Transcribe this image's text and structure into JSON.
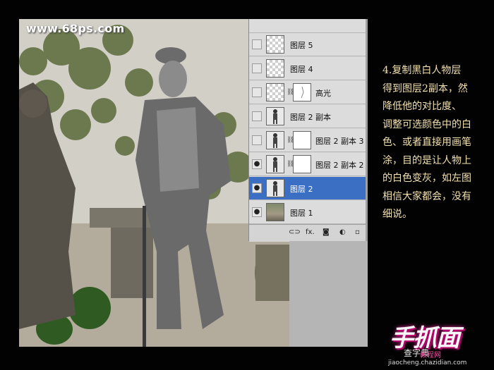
{
  "watermark": "www.68ps.com",
  "layers": [
    {
      "name": "图层 5",
      "visible": false,
      "thumb": "checker",
      "link": false,
      "mask": false
    },
    {
      "name": "图层 4",
      "visible": false,
      "thumb": "checker",
      "link": false,
      "mask": false
    },
    {
      "name": "高光",
      "visible": false,
      "thumb": "checker",
      "link": true,
      "mask": false,
      "mask_thumb": "figure-outline"
    },
    {
      "name": "图层 2 副本",
      "visible": false,
      "thumb": "figure",
      "link": false,
      "mask": false
    },
    {
      "name": "图层 2 副本 3",
      "visible": false,
      "thumb": "figure",
      "link": true,
      "mask": true
    },
    {
      "name": "图层 2 副本 2",
      "visible": true,
      "thumb": "figure",
      "link": true,
      "mask": true
    },
    {
      "name": "图层 2",
      "visible": true,
      "thumb": "figure",
      "link": false,
      "mask": false,
      "selected": true
    },
    {
      "name": "图层 1",
      "visible": true,
      "thumb": "photo",
      "link": false,
      "mask": false
    }
  ],
  "panel_footer": {
    "link_icon": "link-icon",
    "fx_label": "fx.",
    "mask_icon": "mask-icon",
    "adjust_icon": "adjustment-icon",
    "new_icon": "new-layer-icon"
  },
  "description": [
    "4.复制黑白人物层",
    "得到图层2副本，然",
    "降低他的对比度、",
    "调整可选颜色中的白",
    "色、或者直接用画笔",
    "涂，目的是让人物上",
    "的白色变灰，如左图",
    "相信大家都会，没有",
    "细说。"
  ],
  "logo": {
    "main": "手抓面",
    "sub": "查字典",
    "sub2": "教程网",
    "url": "jiaocheng.chazidian.com"
  },
  "colors": {
    "background": "#020202",
    "selected": "#3a6fc4",
    "text": "#f2e0ad",
    "logo_glow": "#ff33aa"
  }
}
